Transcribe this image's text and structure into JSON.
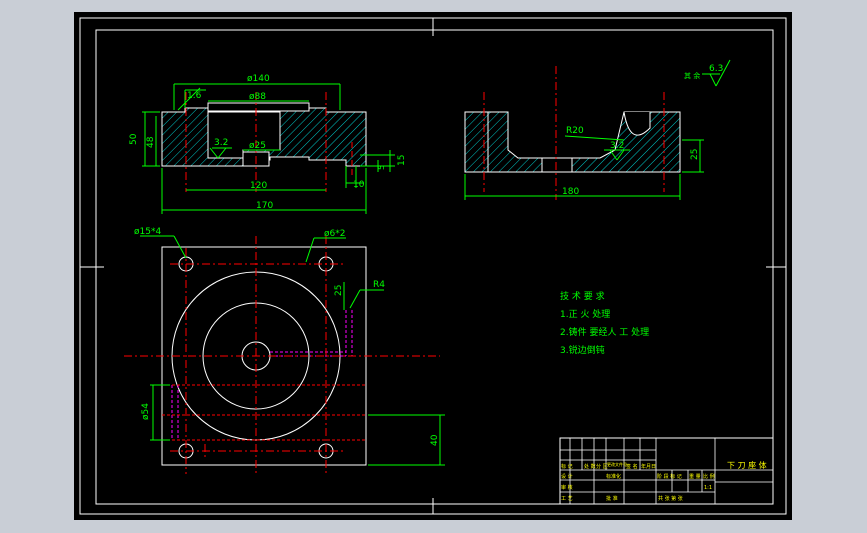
{
  "colors": {
    "outer_bg": "#c9ced6",
    "drawing_bg": "#000000",
    "frame": "#ffffff",
    "dimension": "#00ff00",
    "center_line": "#ff0000",
    "hatch": "#00ffff",
    "hidden_line": "#ff00ff",
    "title_text": "#ffff00"
  },
  "top_view_dims": {
    "d140": "ø140",
    "d88": "ø88",
    "chamfer": "1.6",
    "d25": "ø25",
    "rough": "3.2",
    "h50": "50",
    "h48": "48",
    "w120": "120",
    "w170": "170",
    "w10": "10",
    "w5": "5",
    "h15": "15"
  },
  "side_view_dims": {
    "r20": "R20",
    "rough": "3.2",
    "h25": "25",
    "w180": "180",
    "rest_label": "其 余",
    "rest_value": "6.3"
  },
  "plan_view_dims": {
    "holes4": "ø15*4",
    "pins2": "ø6*2",
    "r4": "R4",
    "v25": "25",
    "d54": "ø54",
    "h40": "40"
  },
  "notes": {
    "title": "技 术 要 求",
    "items": [
      "1.正 火 处理",
      "2.铸件 要经人 工 处理",
      "3.锐边倒钝"
    ]
  },
  "title_block": {
    "part_name": "下 刀 座 体",
    "row_marks": [
      "标 记",
      "处 数",
      "分 区",
      "更改文件号",
      "签 名",
      "年月日"
    ],
    "row_design": [
      "设 计",
      "标准化",
      "阶 段 标 记",
      "重 量",
      "比 例"
    ],
    "row_check": [
      "审 核"
    ],
    "row_process": [
      "工 艺",
      "批 准"
    ],
    "sheet": "共   张 第   张",
    "ratio": "1:1"
  }
}
